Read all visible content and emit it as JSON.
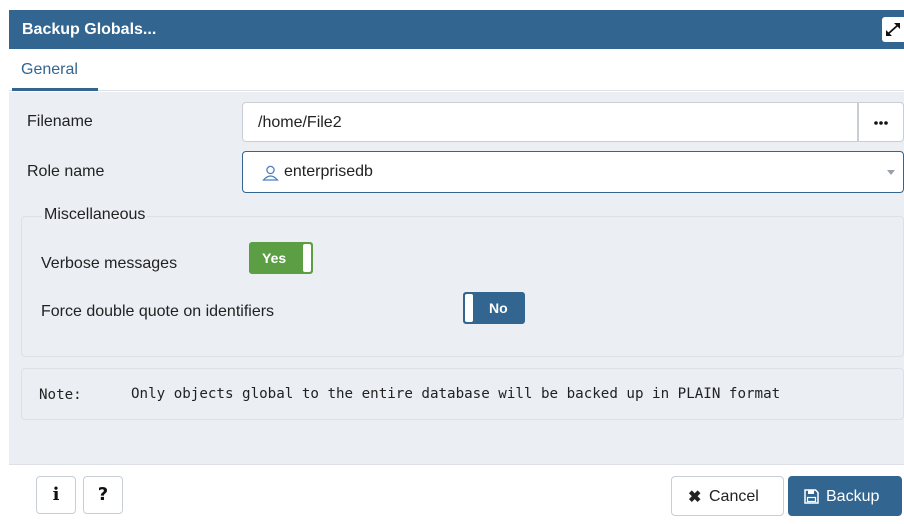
{
  "dialog": {
    "title": "Backup Globals...",
    "tabs": [
      {
        "label": "General",
        "active": true
      }
    ]
  },
  "form": {
    "filename": {
      "label": "Filename",
      "value": "/home/File2",
      "browse_label": "..."
    },
    "role": {
      "label": "Role name",
      "value": "enterprisedb",
      "icon": "user-icon"
    },
    "misc": {
      "legend": "Miscellaneous",
      "verbose": {
        "label": "Verbose messages",
        "value": "Yes",
        "on": true
      },
      "force_quote": {
        "label": "Force double quote on identifiers",
        "value": "No",
        "on": false
      }
    },
    "note": {
      "label": "Note:",
      "text": "Only objects global to the entire database will be backed up in PLAIN format"
    }
  },
  "footer": {
    "info_label": "i",
    "help_label": "?",
    "cancel_label": "Cancel",
    "backup_label": "Backup"
  },
  "colors": {
    "primary": "#326690",
    "toggle_on": "#5b9e44",
    "panel_bg": "#ebeef3"
  }
}
